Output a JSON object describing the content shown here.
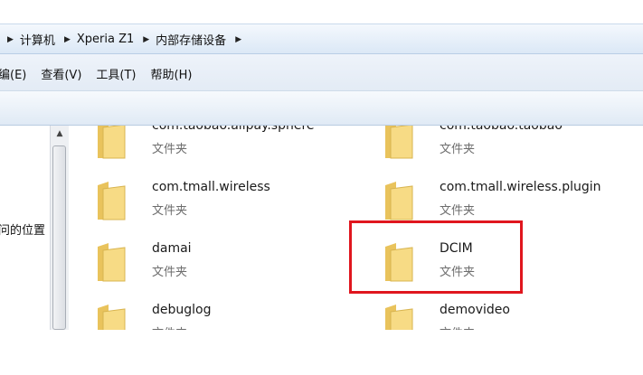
{
  "address": {
    "crumbs": [
      "计算机",
      "Xperia Z1",
      "内部存储设备"
    ]
  },
  "menu": {
    "items": [
      "编(E)",
      "查看(V)",
      "工具(T)",
      "帮助(H)"
    ]
  },
  "navigation": {
    "visible_text": "问的位置"
  },
  "scrollbar": {
    "up_arrow": "▲"
  },
  "files": [
    {
      "name": "com.taobao.alipay.sphere",
      "type": "文件夹"
    },
    {
      "name": "com.taobao.taobao",
      "type": "文件夹"
    },
    {
      "name": "com.tmall.wireless",
      "type": "文件夹"
    },
    {
      "name": "com.tmall.wireless.plugin",
      "type": "文件夹"
    },
    {
      "name": "damai",
      "type": "文件夹"
    },
    {
      "name": "DCIM",
      "type": "文件夹"
    },
    {
      "name": "debuglog",
      "type": "文件夹"
    },
    {
      "name": "demovideo",
      "type": "文件夹"
    }
  ],
  "colors": {
    "highlight": "#e0161e",
    "folder": "#f5d67a"
  },
  "icons": {
    "folder": "folder-icon",
    "breadcrumb_arrow": "triangle-right-icon",
    "scroll_up": "triangle-up-icon"
  }
}
